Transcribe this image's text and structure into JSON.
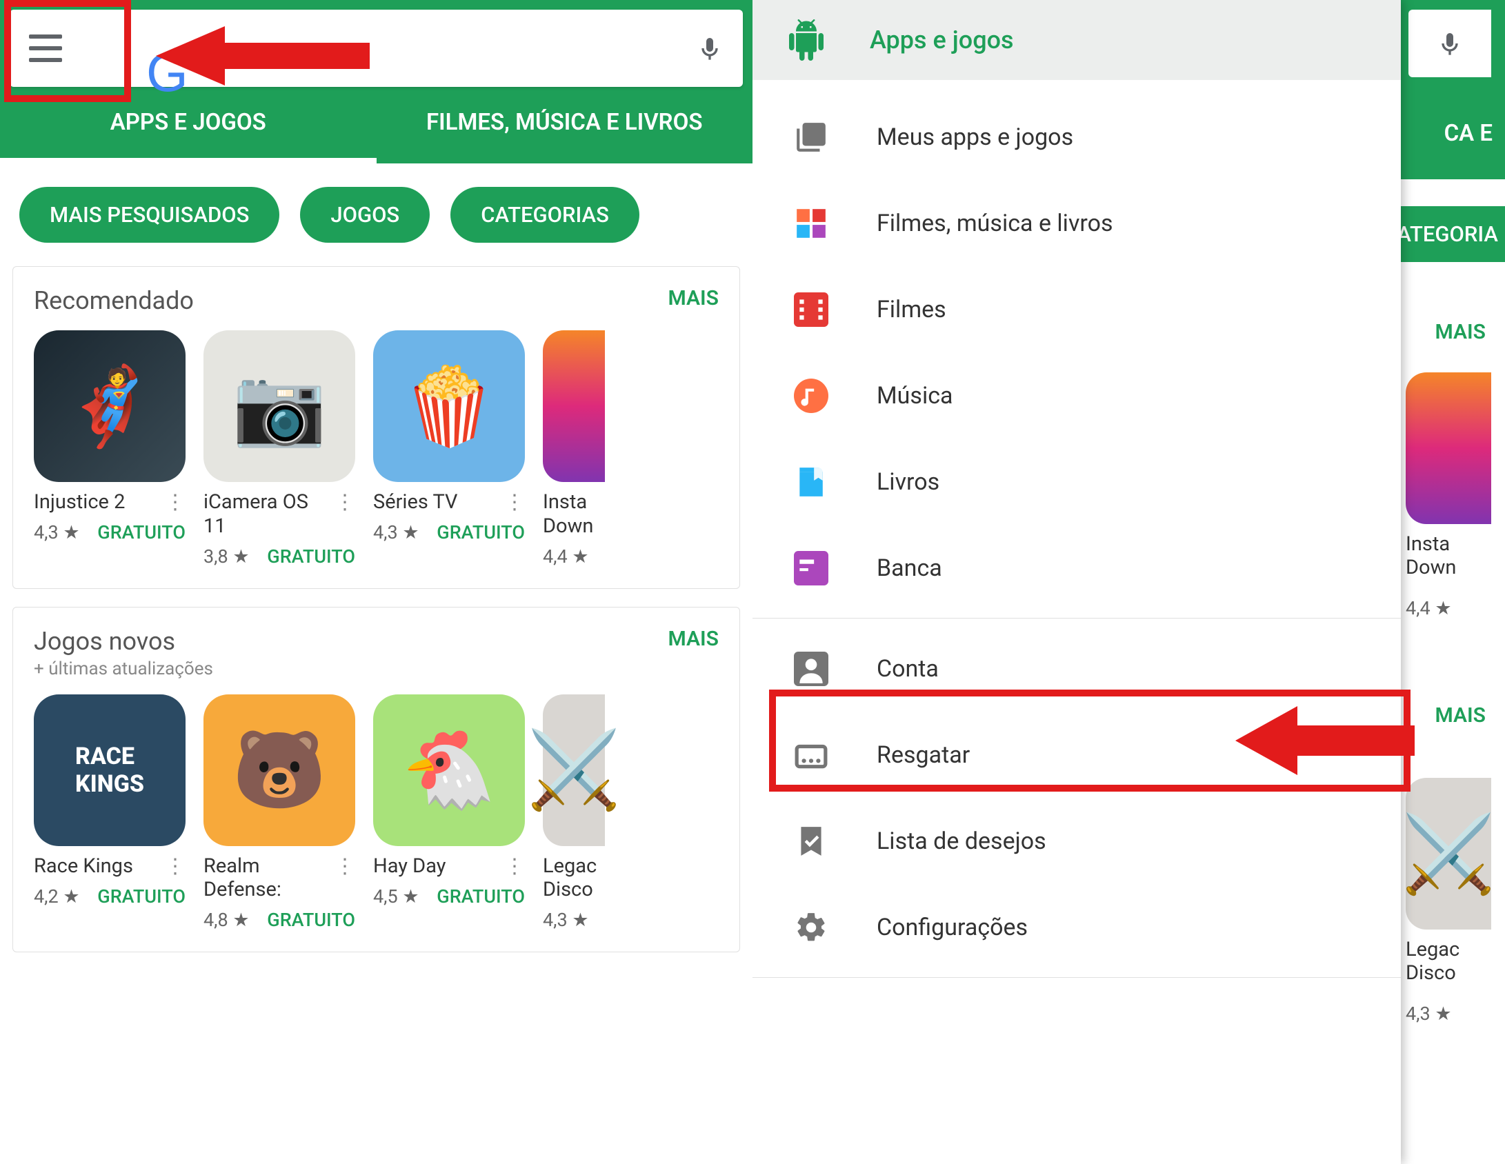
{
  "panel1": {
    "tabs": [
      {
        "label": "APPS E JOGOS",
        "active": true
      },
      {
        "label": "FILMES, MÚSICA E LIVROS",
        "active": false
      }
    ],
    "chips": [
      "MAIS PESQUISADOS",
      "JOGOS",
      "CATEGORIAS"
    ],
    "section1": {
      "title": "Recomendado",
      "more": "MAIS",
      "apps": [
        {
          "name": "Injustice 2",
          "rating": "4,3 ★",
          "price": "GRATUITO",
          "bg": "#2a3b45"
        },
        {
          "name": "iCamera OS 11",
          "rating": "3,8 ★",
          "price": "GRATUITO",
          "bg": "#e5e5e0"
        },
        {
          "name": "Séries TV",
          "rating": "4,3 ★",
          "price": "GRATUITO",
          "bg": "#6db4e8"
        },
        {
          "name": "Insta Down",
          "rating": "4,4 ★",
          "price": "",
          "bg": "#ffffff"
        }
      ]
    },
    "section2": {
      "title": "Jogos novos",
      "subtitle": "+ últimas atualizações",
      "more": "MAIS",
      "apps": [
        {
          "name": "Race Kings",
          "rating": "4,2 ★",
          "price": "GRATUITO",
          "bg": "#2b4a63"
        },
        {
          "name": "Realm Defense:",
          "rating": "4,8 ★",
          "price": "GRATUITO",
          "bg": "#f7a93b"
        },
        {
          "name": "Hay Day",
          "rating": "4,5 ★",
          "price": "GRATUITO",
          "bg": "#a8e27a"
        },
        {
          "name": "Legac Disco",
          "rating": "4,3 ★",
          "price": "",
          "bg": "#d9d6d2"
        }
      ]
    }
  },
  "panel2": {
    "drawer": {
      "header": "Apps e jogos",
      "groups": [
        [
          {
            "icon": "library-icon",
            "label": "Meus apps e jogos"
          },
          {
            "icon": "media-icon",
            "label": "Filmes, música e livros"
          },
          {
            "icon": "film-icon",
            "label": "Filmes"
          },
          {
            "icon": "music-icon",
            "label": "Música"
          },
          {
            "icon": "book-icon",
            "label": "Livros"
          },
          {
            "icon": "news-icon",
            "label": "Banca"
          }
        ],
        [
          {
            "icon": "account-icon",
            "label": "Conta"
          },
          {
            "icon": "redeem-icon",
            "label": "Resgatar"
          },
          {
            "icon": "wishlist-icon",
            "label": "Lista de desejos"
          },
          {
            "icon": "settings-icon",
            "label": "Configurações"
          }
        ]
      ]
    },
    "peek": {
      "tab_fragment": "CA E",
      "chip_fragment": "ATEGORIA",
      "more": "MAIS",
      "app1": {
        "name": "Insta Down",
        "rating": "4,4 ★"
      },
      "app2": {
        "name": "Legac Disco",
        "rating": "4,3 ★"
      }
    }
  }
}
